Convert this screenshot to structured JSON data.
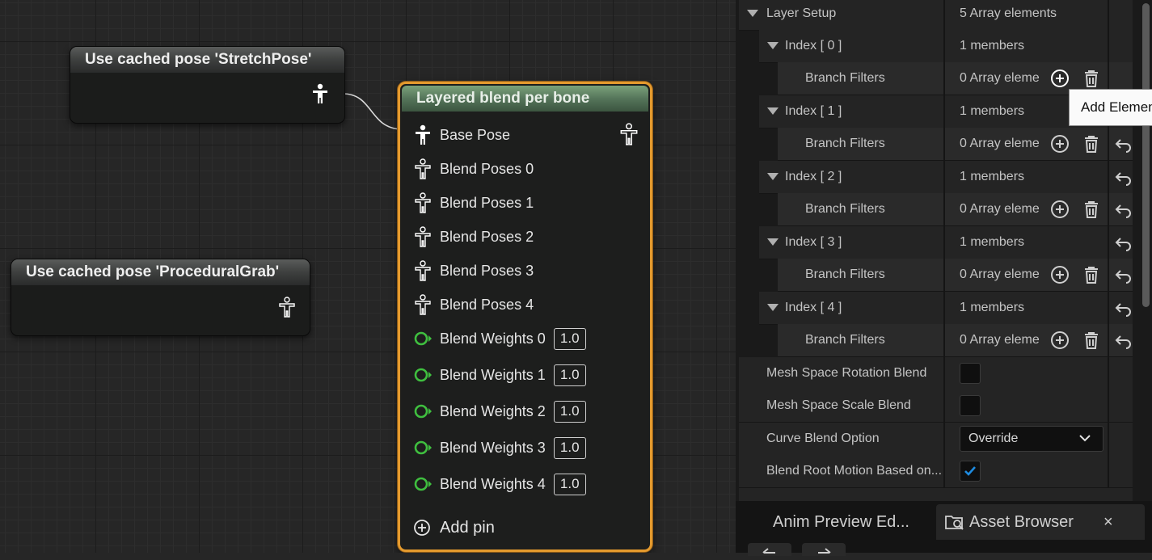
{
  "graph": {
    "node_stretch": {
      "title": "Use cached pose 'StretchPose'"
    },
    "node_grab": {
      "title": "Use cached pose 'ProceduralGrab'"
    },
    "blend_node": {
      "title": "Layered blend per bone",
      "base_pose": "Base Pose",
      "blend_poses": [
        "Blend Poses 0",
        "Blend Poses 1",
        "Blend Poses 2",
        "Blend Poses 3",
        "Blend Poses 4"
      ],
      "blend_weights": [
        {
          "label": "Blend Weights 0",
          "value": "1.0"
        },
        {
          "label": "Blend Weights 1",
          "value": "1.0"
        },
        {
          "label": "Blend Weights 2",
          "value": "1.0"
        },
        {
          "label": "Blend Weights 3",
          "value": "1.0"
        },
        {
          "label": "Blend Weights 4",
          "value": "1.0"
        }
      ],
      "add_pin": "Add pin"
    }
  },
  "details": {
    "layer_setup": {
      "label": "Layer Setup",
      "value": "5 Array elements"
    },
    "indices": [
      {
        "label": "Index [ 0 ]",
        "value": "1 members",
        "filter_label": "Branch Filters",
        "filter_value": "0 Array eleme"
      },
      {
        "label": "Index [ 1 ]",
        "value": "1 members",
        "filter_label": "Branch Filters",
        "filter_value": "0 Array eleme"
      },
      {
        "label": "Index [ 2 ]",
        "value": "1 members",
        "filter_label": "Branch Filters",
        "filter_value": "0 Array eleme"
      },
      {
        "label": "Index [ 3 ]",
        "value": "1 members",
        "filter_label": "Branch Filters",
        "filter_value": "0 Array eleme"
      },
      {
        "label": "Index [ 4 ]",
        "value": "1 members",
        "filter_label": "Branch Filters",
        "filter_value": "0 Array eleme"
      }
    ],
    "mesh_rotation": {
      "label": "Mesh Space Rotation Blend",
      "checked": false
    },
    "mesh_scale": {
      "label": "Mesh Space Scale Blend",
      "checked": false
    },
    "curve_blend": {
      "label": "Curve Blend Option",
      "value": "Override"
    },
    "root_motion": {
      "label": "Blend Root Motion Based on...",
      "checked": true
    },
    "tooltip": "Add Element"
  },
  "tabs": {
    "anim_preview": "Anim Preview Ed...",
    "asset_browser": "Asset Browser",
    "close": "×"
  },
  "colors": {
    "node_border": "#e49a2e",
    "blend_header": "#55755a",
    "weight_pin": "#3fbf3f",
    "check": "#1e8be0"
  }
}
